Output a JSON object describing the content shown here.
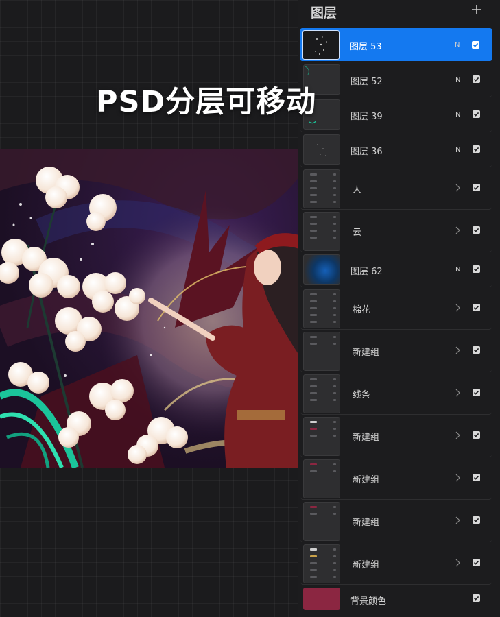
{
  "overlay_caption": "PSD分层可移动",
  "layers_panel": {
    "title": "图层",
    "add_icon": "plus-icon",
    "layers": [
      {
        "name": "图层 53",
        "blend_mode": "N",
        "visible": true,
        "selected": true,
        "type": "layer"
      },
      {
        "name": "图层 52",
        "blend_mode": "N",
        "visible": true,
        "selected": false,
        "type": "layer"
      },
      {
        "name": "图层 39",
        "blend_mode": "N",
        "visible": true,
        "selected": false,
        "type": "layer"
      },
      {
        "name": "图层 36",
        "blend_mode": "N",
        "visible": true,
        "selected": false,
        "type": "layer"
      },
      {
        "name": "人",
        "visible": true,
        "selected": false,
        "type": "group"
      },
      {
        "name": "云",
        "visible": true,
        "selected": false,
        "type": "group"
      },
      {
        "name": "图层 62",
        "blend_mode": "N",
        "visible": true,
        "selected": false,
        "type": "layer"
      },
      {
        "name": "棉花",
        "visible": true,
        "selected": false,
        "type": "group"
      },
      {
        "name": "新建组",
        "visible": true,
        "selected": false,
        "type": "group"
      },
      {
        "name": "线条",
        "visible": true,
        "selected": false,
        "type": "group"
      },
      {
        "name": "新建组",
        "visible": true,
        "selected": false,
        "type": "group"
      },
      {
        "name": "新建组",
        "visible": true,
        "selected": false,
        "type": "group"
      },
      {
        "name": "新建组",
        "visible": true,
        "selected": false,
        "type": "group"
      },
      {
        "name": "新建组",
        "visible": true,
        "selected": false,
        "type": "group"
      },
      {
        "name": "背景颜色",
        "visible": true,
        "selected": false,
        "type": "background",
        "color": "#8b2641"
      }
    ]
  },
  "colors": {
    "accent": "#1479f0",
    "panel_bg": "#1c1c1e",
    "canvas_bg": "#1b1b1d"
  }
}
